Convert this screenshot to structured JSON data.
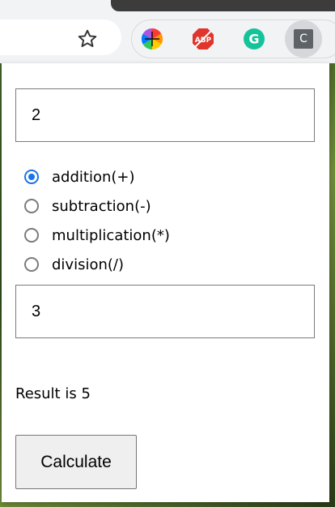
{
  "browser": {
    "toolbar_icons": [
      "star-icon",
      "color-wheel-icon",
      "adblock-plus-icon",
      "grammarly-icon",
      "calculator-extension-icon"
    ],
    "abp_text": "ABP",
    "grammarly_letter": "G",
    "calc_ext_letter": "C",
    "colors": {
      "accent": "#1a73e8",
      "abp_red": "#e0342c",
      "grammarly_green": "#15c39a"
    }
  },
  "calculator": {
    "first_value": "2",
    "operations": [
      {
        "label": "addition(+)",
        "checked": true
      },
      {
        "label": "subtraction(-)",
        "checked": false
      },
      {
        "label": "multiplication(*)",
        "checked": false
      },
      {
        "label": "division(/)",
        "checked": false
      }
    ],
    "second_value": "3",
    "result_text": "Result is 5",
    "calculate_label": "Calculate"
  }
}
